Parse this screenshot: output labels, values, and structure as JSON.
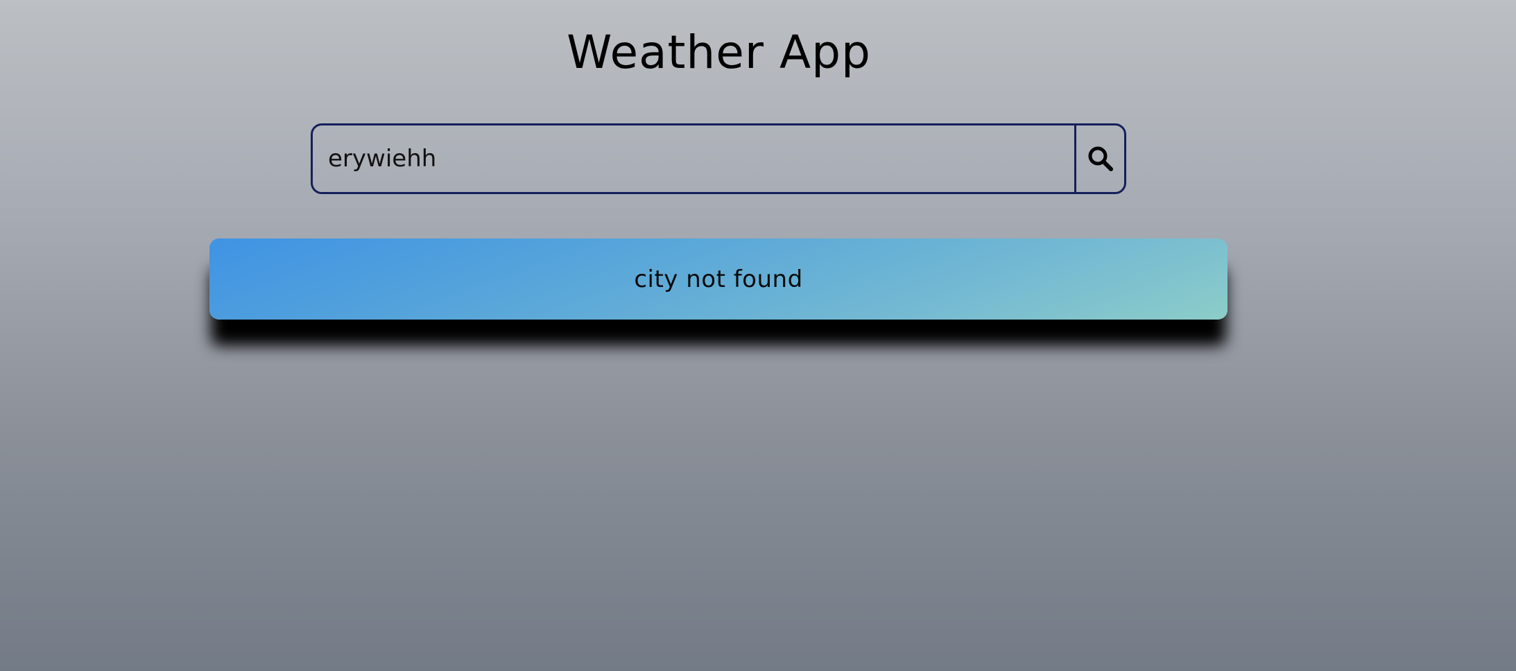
{
  "header": {
    "title": "Weather App"
  },
  "search": {
    "value": "erywiehh",
    "placeholder": "",
    "button_icon": "search-icon"
  },
  "result": {
    "message": "city not found"
  },
  "colors": {
    "border": "#141f5a",
    "card_gradient_start": "#3f93e3",
    "card_gradient_end": "#8ccdc8",
    "background_top": "#bcc0c4",
    "background_bottom": "#737b86"
  }
}
